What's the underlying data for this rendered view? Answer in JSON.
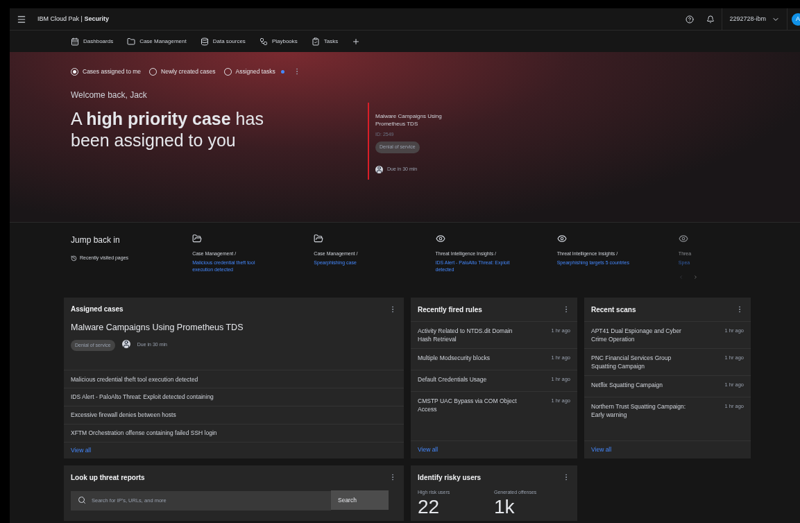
{
  "header": {
    "brand": "IBM Cloud Pak | **Security**",
    "account": "2292728-ibm",
    "avatar": "A"
  },
  "nav": {
    "tabs": [
      {
        "label": "Dashboards",
        "kind": "calendar"
      },
      {
        "label": "Case Management",
        "kind": "folder"
      },
      {
        "label": "Data sources",
        "kind": "database"
      },
      {
        "label": "Playbooks",
        "kind": "flow"
      },
      {
        "label": "Tasks",
        "kind": "clipboard"
      }
    ]
  },
  "hero": {
    "filters": [
      {
        "label": "Cases assigned to me",
        "selected": true,
        "notification": false
      },
      {
        "label": "Newly created cases",
        "selected": false,
        "notification": false
      },
      {
        "label": "Assigned tasks",
        "selected": false,
        "notification": true
      }
    ],
    "welcome": "Welcome back, Jack",
    "headline": "A **high priority case** has been assigned to you",
    "case": {
      "title": "Malware Campaigns Using Prometheus TDS",
      "id": "ID: 2549",
      "tag": "Denial of service",
      "due": "Due in 30 min"
    }
  },
  "jump": {
    "title": "Jump back in",
    "subtitle": "Recently visited pages",
    "items": [
      {
        "kind": "case",
        "section": "Case Management /",
        "link": "Malicious credential theft tool execution detected",
        "faded": false
      },
      {
        "kind": "case",
        "section": "Case Management /",
        "link": "Spearphishing case",
        "faded": false
      },
      {
        "kind": "insight",
        "section": "Threat Intelligence Insights /",
        "link": "IDS Alert - PaloAlto Threat: Exploit detected",
        "faded": false
      },
      {
        "kind": "insight",
        "section": "Threat Intelligence Insights /",
        "link": "Spearphishing targets 5 countries",
        "faded": false
      },
      {
        "kind": "insight",
        "section": "Threa",
        "link": "Spea",
        "faded": true
      }
    ]
  },
  "assigned_cases": {
    "title": "Assigned cases",
    "case": {
      "title": "Malware Campaigns Using Prometheus TDS",
      "tag": "Denial of service",
      "due": "Due in 30 min"
    },
    "items": [
      "Malicious credential theft tool execution detected",
      "IDS Alert - PaloAlto Threat: Exploit detected containing",
      "Excessive firewall denies between hosts",
      "XFTM Orchestration offense containing failed SSH login"
    ],
    "link": "View all"
  },
  "recently_fired_rules": {
    "title": "Recently fired rules",
    "items": [
      {
        "name": "Activity Related to NTDS.dit Domain Hash Retrieval",
        "time": "1 hr ago"
      },
      {
        "name": "Multiple Modsecurity blocks",
        "time": "1 hr ago"
      },
      {
        "name": "Default Credentials Usage",
        "time": "1 hr ago"
      },
      {
        "name": "CMSTP UAC Bypass via COM Object Access",
        "time": "1 hr ago"
      }
    ],
    "link": "View all"
  },
  "recent_scans": {
    "title": "Recent scans",
    "items": [
      {
        "name": "APT41 Dual Espionage and Cyber Crime Operation",
        "time": "1 hr ago"
      },
      {
        "name": "PNC Financial Services Group Squatting Campaign",
        "time": "1 hr ago"
      },
      {
        "name": "Netflix Squatting Campaign",
        "time": "1 hr ago"
      },
      {
        "name": "Northern Trust Squatting Campaign: Early warning",
        "time": "1 hr ago"
      }
    ],
    "link": "View all"
  },
  "threat_lookup": {
    "title": "Look up threat reports",
    "placeholder": "Search for IP's, URLs, and more",
    "button": "Search"
  },
  "risky_users": {
    "title": "Identify risky users",
    "stats": [
      {
        "label": "High risk users",
        "value": "22"
      },
      {
        "label": "Generated offenses",
        "value": "1k"
      }
    ]
  }
}
